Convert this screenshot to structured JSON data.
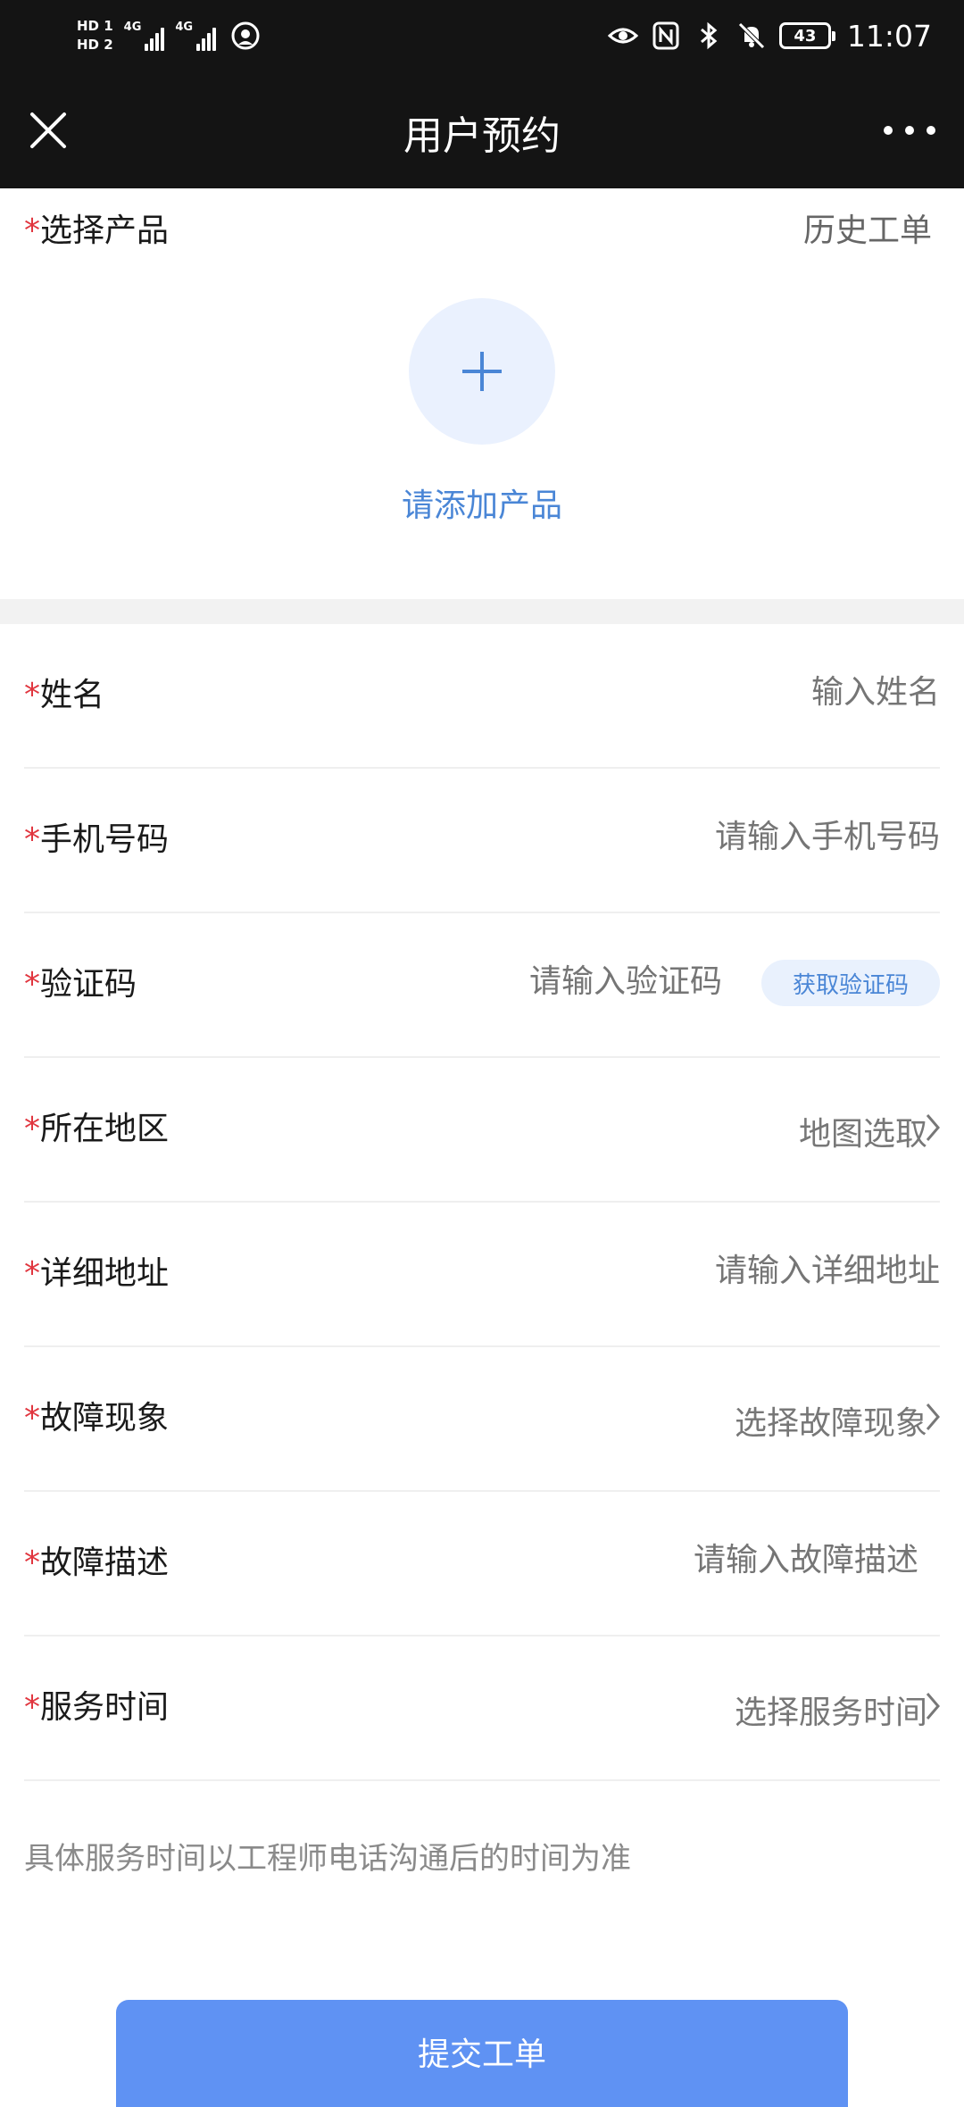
{
  "status_bar": {
    "sim1": "HD 1",
    "sim2": "HD 2",
    "network1": "4G",
    "network2": "4G",
    "battery": "43",
    "time": "11:07"
  },
  "header": {
    "title": "用户预约",
    "close_icon": "close-icon",
    "more_icon": "more-dots-icon"
  },
  "product": {
    "required_mark": "*",
    "label": "选择产品",
    "history_link": "历史工单",
    "add_text": "请添加产品"
  },
  "form": {
    "name": {
      "label": "姓名",
      "placeholder": "输入姓名"
    },
    "phone": {
      "label": "手机号码",
      "placeholder": "请输入手机号码"
    },
    "code": {
      "label": "验证码",
      "placeholder": "请输入验证码",
      "button": "获取验证码"
    },
    "region": {
      "label": "所在地区",
      "value": "地图选取"
    },
    "address": {
      "label": "详细地址",
      "placeholder": "请输入详细地址"
    },
    "fault": {
      "label": "故障现象",
      "value": "选择故障现象"
    },
    "description": {
      "label": "故障描述",
      "placeholder": "请输入故障描述"
    },
    "service_time": {
      "label": "服务时间",
      "value": "选择服务时间"
    }
  },
  "note": "具体服务时间以工程师电话沟通后的时间为准",
  "submit_label": "提交工单",
  "colors": {
    "accent": "#5f92f3",
    "link": "#4a86d6",
    "required": "#e1363f",
    "header_bg": "#141414"
  }
}
